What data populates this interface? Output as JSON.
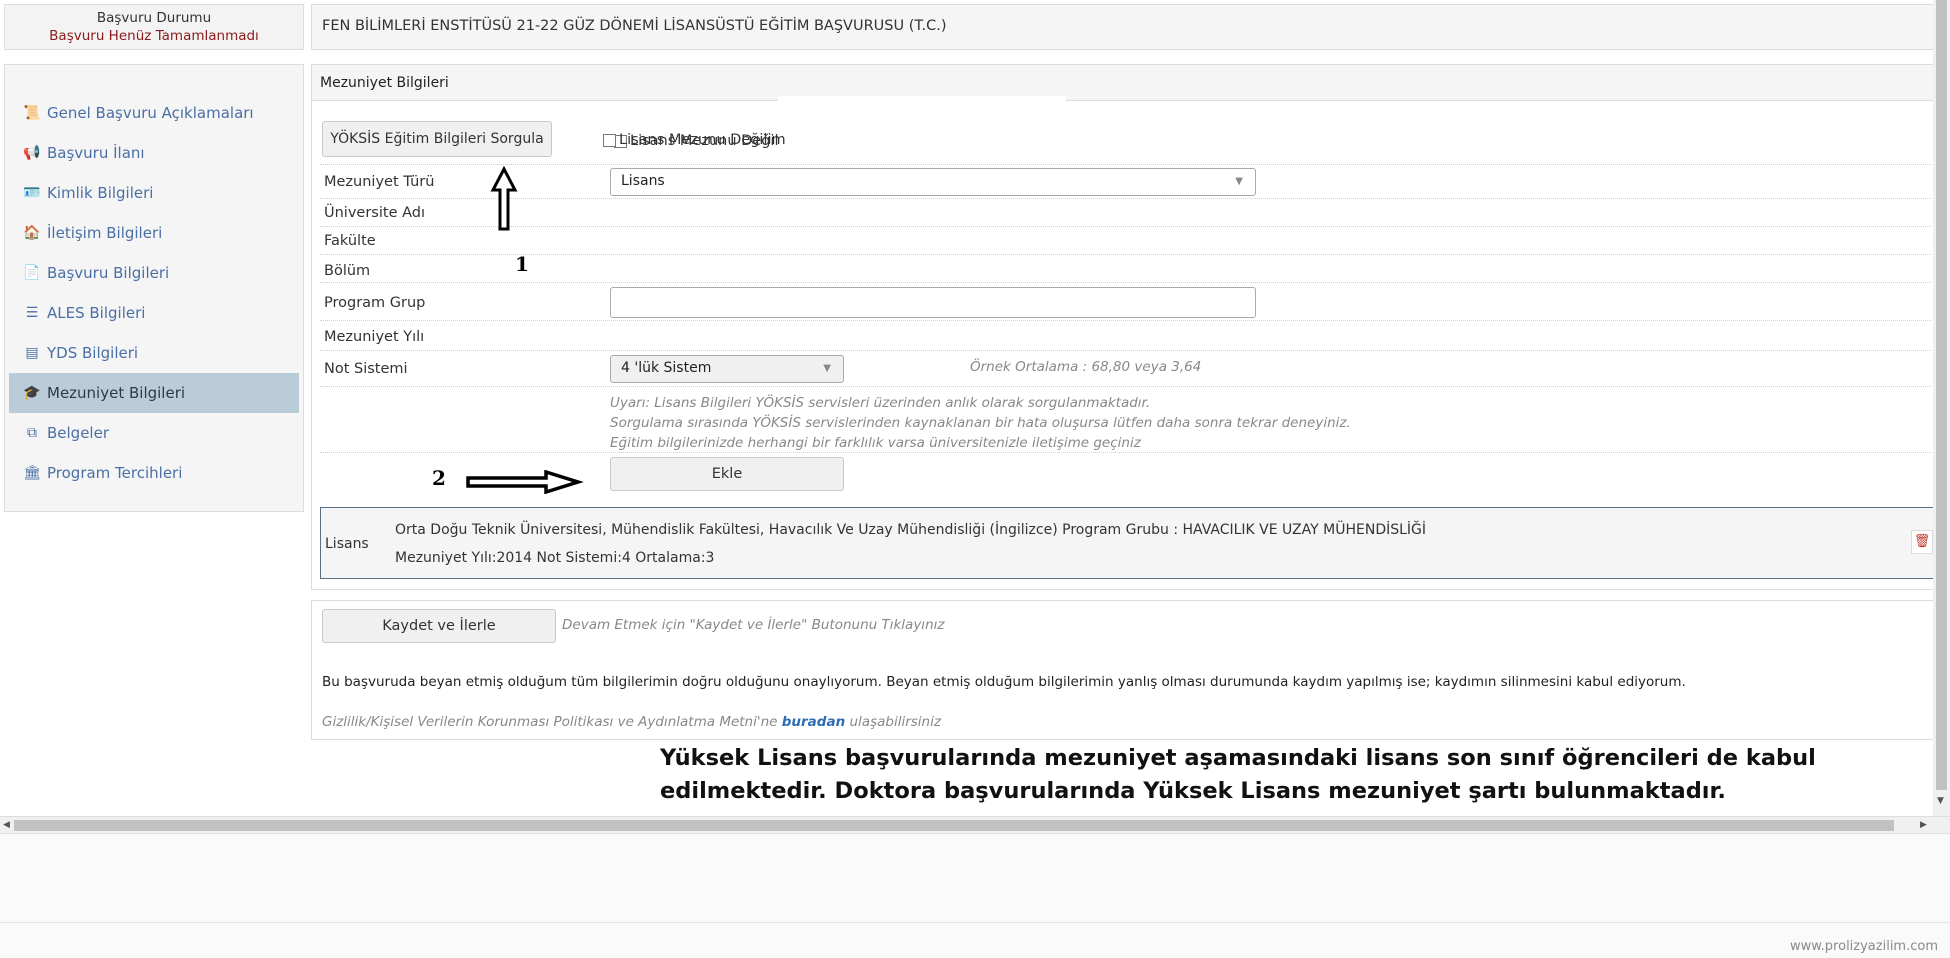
{
  "status": {
    "title": "Başvuru Durumu",
    "value": "Başvuru Henüz Tamamlanmadı"
  },
  "header": {
    "title": "FEN BİLİMLERİ ENSTİTÜSÜ 21-22 GÜZ DÖNEMİ LİSANSÜSTÜ EĞİTİM BAŞVURUSU (T.C.)"
  },
  "sidebar": {
    "items": [
      {
        "label": "Genel Başvuru Açıklamaları",
        "icon": "scroll-icon",
        "glyph": "📜"
      },
      {
        "label": "Başvuru İlanı",
        "icon": "megaphone-icon",
        "glyph": "📢"
      },
      {
        "label": "Kimlik Bilgileri",
        "icon": "id-card-icon",
        "glyph": "🪪"
      },
      {
        "label": "İletişim Bilgileri",
        "icon": "address-book-icon",
        "glyph": "🏠"
      },
      {
        "label": "Başvuru Bilgileri",
        "icon": "document-icon",
        "glyph": "📄"
      },
      {
        "label": "ALES Bilgileri",
        "icon": "list-icon",
        "glyph": "☰"
      },
      {
        "label": "YDS Bilgileri",
        "icon": "table-icon",
        "glyph": "▤"
      },
      {
        "label": "Mezuniyet Bilgileri",
        "icon": "graduation-cap-icon",
        "glyph": "🎓"
      },
      {
        "label": "Belgeler",
        "icon": "copy-icon",
        "glyph": "⧉"
      },
      {
        "label": "Program Tercihleri",
        "icon": "institution-icon",
        "glyph": "🏛"
      }
    ],
    "active_index": 7
  },
  "panel": {
    "title": "Mezuniyet Bilgileri",
    "yoksis_button": "YÖKSİS Eğitim Bilgileri Sorgula",
    "not_graduate_checkbox": "Lisans Mezunu Değilim",
    "fields": {
      "mezuniyet_turu_label": "Mezuniyet Türü",
      "mezuniyet_turu_value": "Lisans",
      "universite_label": "Üniversite Adı",
      "fakulte_label": "Fakülte",
      "bolum_label": "Bölüm",
      "program_grup_label": "Program Grup",
      "mezuniyet_yili_label": "Mezuniyet Yılı",
      "not_sistemi_label": "Not Sistemi",
      "not_sistemi_value": "4 'lük Sistem",
      "ornek_ortalama": "Örnek Ortalama : 68,80 veya 3,64"
    },
    "warnings": [
      "Uyarı: Lisans Bilgileri YÖKSİS servisleri üzerinden anlık olarak sorgulanmaktadır.",
      "Sorgulama sırasında YÖKSİS servislerinden kaynaklanan bir hata oluşursa lütfen daha sonra tekrar deneyiniz.",
      "Eğitim bilgilerinizde herhangi bir farklılık varsa üniversitenizle iletişime geçiniz"
    ],
    "add_button": "Ekle",
    "record": {
      "type": "Lisans",
      "line1": "Orta Doğu Teknik Üniversitesi, Mühendislik Fakültesi, Havacılık Ve Uzay Mühendisliği (İngilizce)  Program Grubu : HAVACILIK VE UZAY MÜHENDİSLİĞİ",
      "line2": "Mezuniyet Yılı:2014   Not Sistemi:4   Ortalama:3",
      "delete_icon": "trash-icon"
    }
  },
  "footer": {
    "save_button": "Kaydet ve İlerle",
    "save_hint": "Devam Etmek için \"Kaydet ve İlerle\" Butonunu Tıklayınız",
    "consent": "Bu başvuruda beyan etmiş olduğum tüm bilgilerimin doğru olduğunu onaylıyorum. Beyan etmiş olduğum bilgilerimin yanlış olması durumunda kaydım yapılmış ise; kaydımın silinmesini kabul ediyorum.",
    "privacy_prefix": "Gizlilik/Kişisel Verilerin Korunması Politikası ve Aydınlatma Metni'ne",
    "privacy_link": "buradan",
    "privacy_suffix": "ulaşabilirsiniz"
  },
  "annotations": {
    "num1": "1",
    "num2": "2",
    "note_line1": "Yüksek Lisans başvurularında mezuniyet aşamasındaki lisans son sınıf öğrencileri de kabul",
    "note_line2": "edilmektedir. Doktora başvurularında Yüksek Lisans mezuniyet şartı bulunmaktadır."
  },
  "watermark": "www.prolizyazilim.com",
  "colors": {
    "active_nav": "#b9ccd8",
    "link": "#2e6cb4",
    "status_red": "#8b1a1a",
    "delete_red": "#c0392b"
  }
}
